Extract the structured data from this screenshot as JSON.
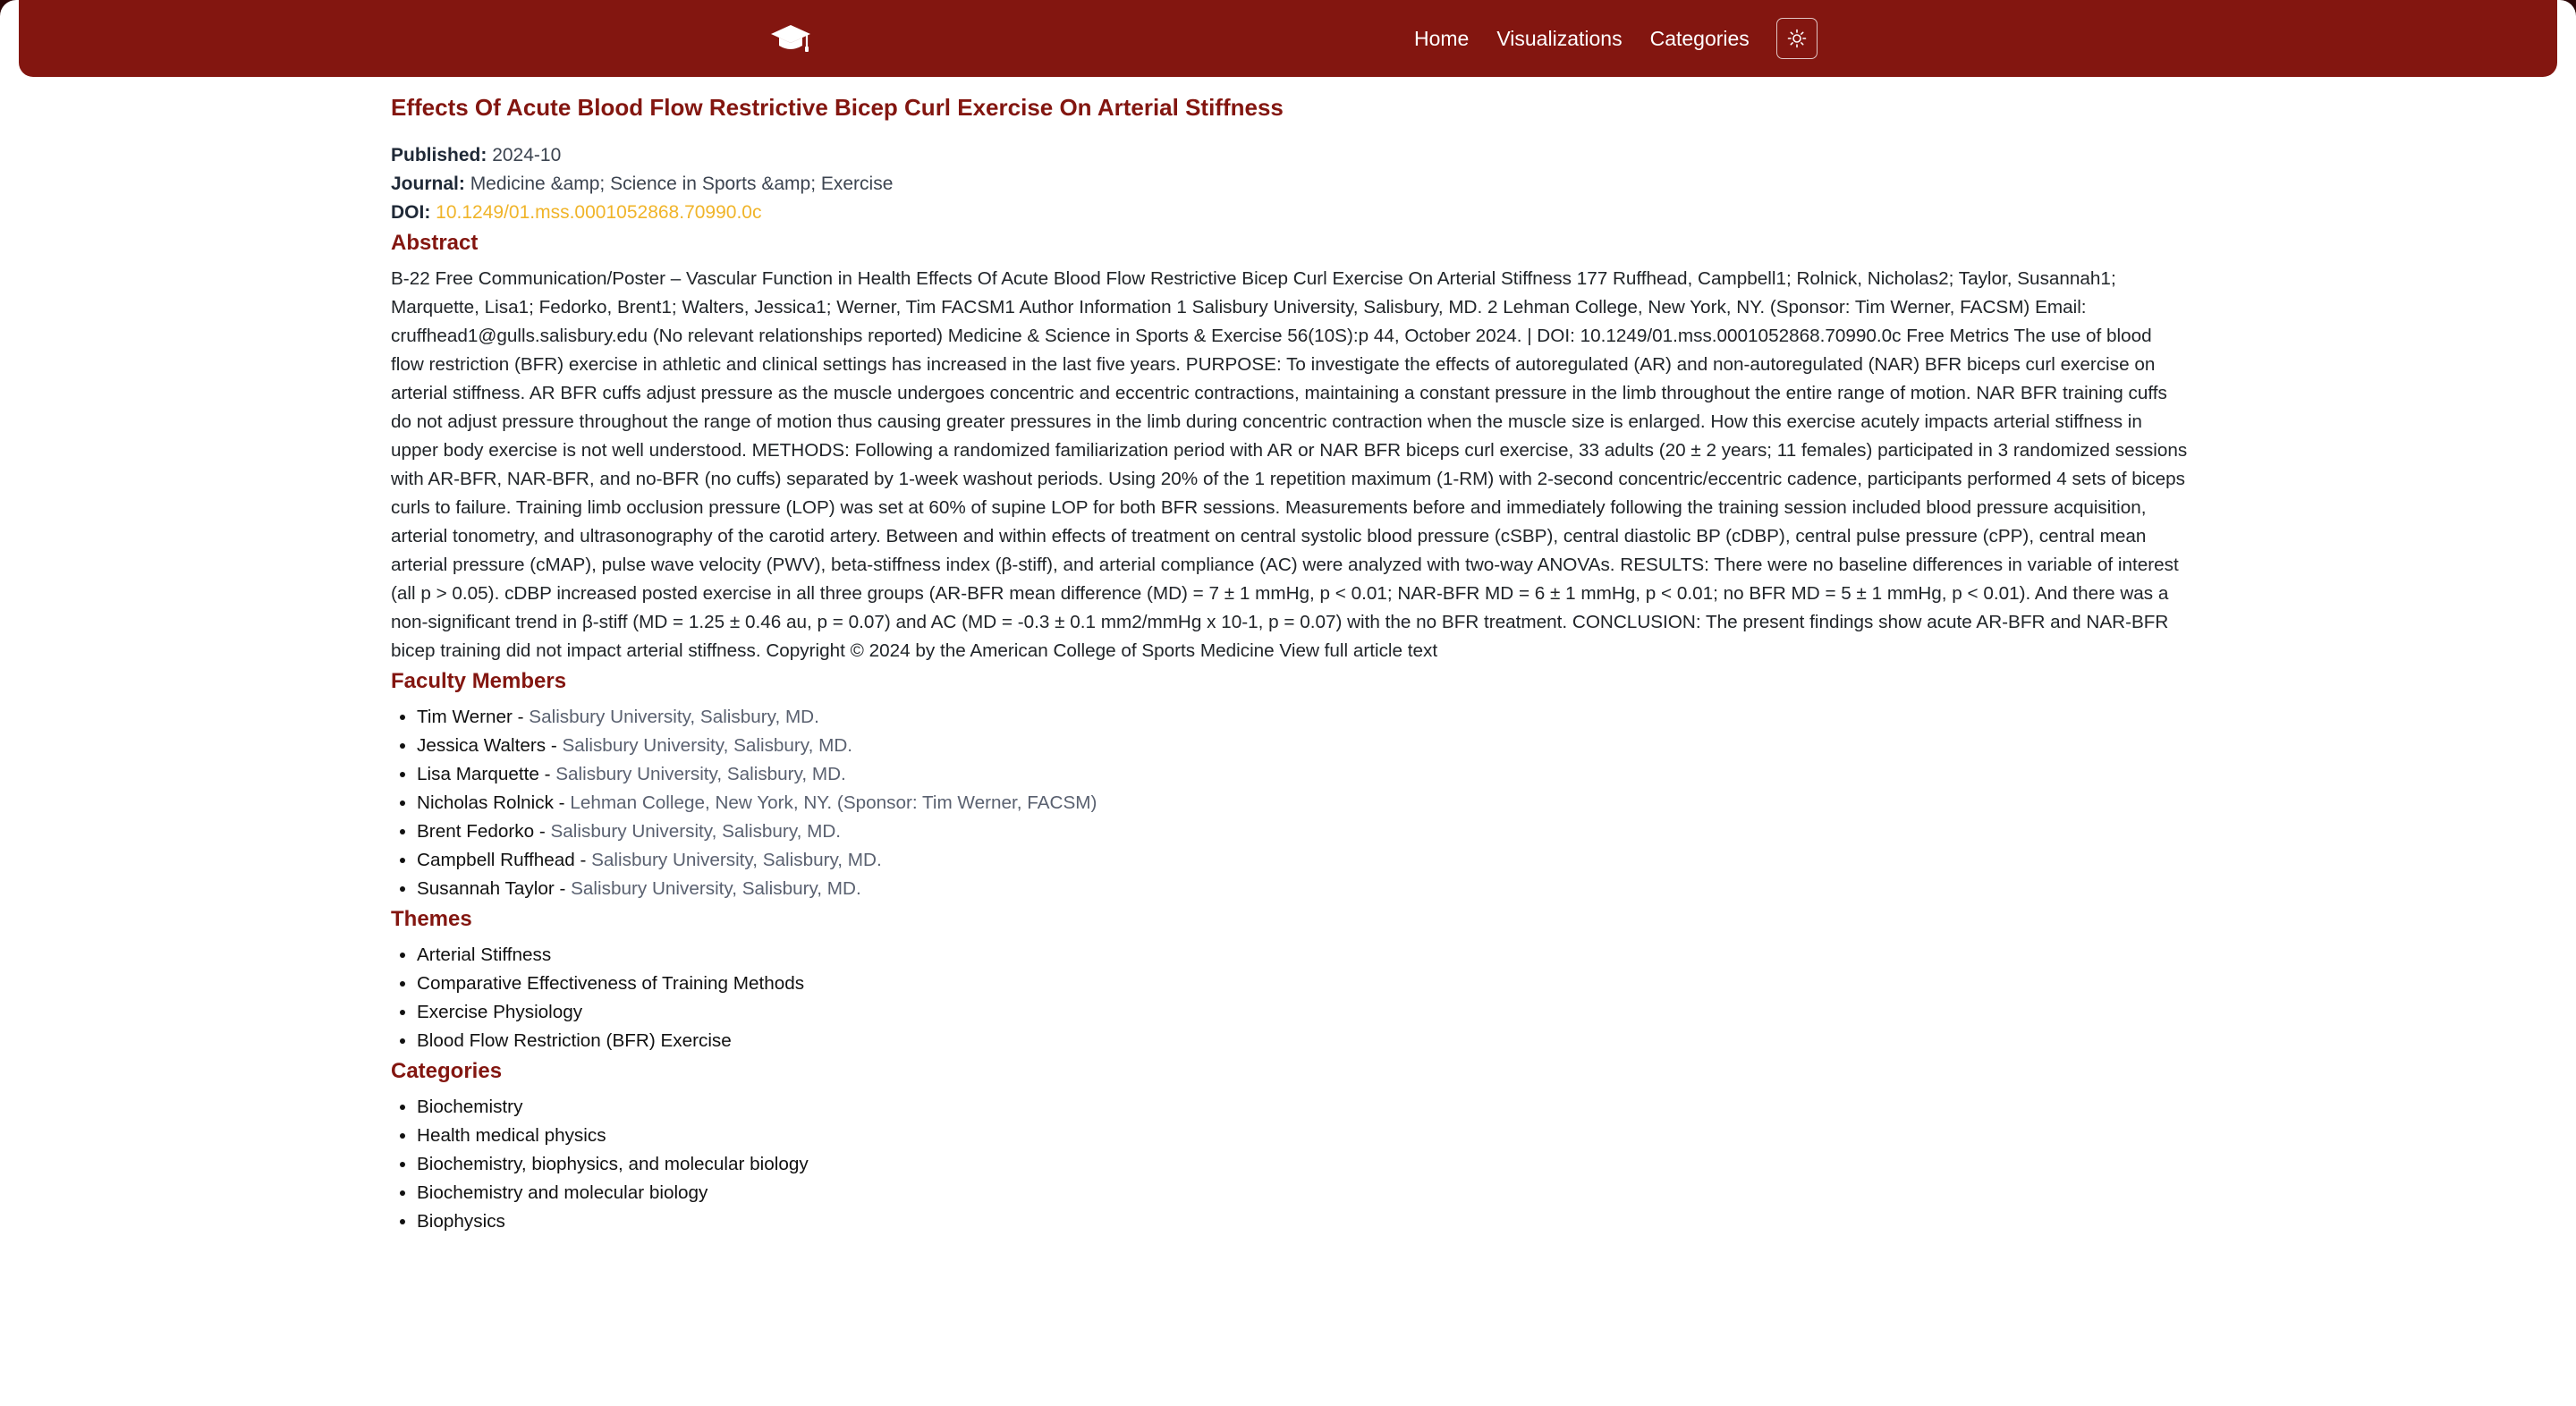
{
  "nav": {
    "links": [
      "Home",
      "Visualizations",
      "Categories"
    ]
  },
  "icons": {
    "logo": "graduation-cap-icon",
    "theme_toggle": "sun-icon"
  },
  "colors": {
    "brand": "#831610",
    "doi_link": "#f0b429",
    "background": "#ffffff"
  },
  "article": {
    "title": "Effects Of Acute Blood Flow Restrictive Bicep Curl Exercise On Arterial Stiffness",
    "published_label": "Published:",
    "published": "2024-10",
    "journal_label": "Journal:",
    "journal": "Medicine &amp; Science in Sports &amp; Exercise",
    "doi_label": "DOI:",
    "doi": "10.1249/01.mss.0001052868.70990.0c"
  },
  "abstract": {
    "heading": "Abstract",
    "text": "B-22 Free Communication/Poster – Vascular Function in Health Effects Of Acute Blood Flow Restrictive Bicep Curl Exercise On Arterial Stiffness 177 Ruffhead, Campbell1; Rolnick, Nicholas2; Taylor, Susannah1; Marquette, Lisa1; Fedorko, Brent1; Walters, Jessica1; Werner, Tim FACSM1 Author Information 1 Salisbury University, Salisbury, MD. 2 Lehman College, New York, NY. (Sponsor: Tim Werner, FACSM) Email: cruffhead1@gulls.salisbury.edu (No relevant relationships reported) Medicine & Science in Sports & Exercise 56(10S):p 44, October 2024. | DOI: 10.1249/01.mss.0001052868.70990.0c Free Metrics The use of blood flow restriction (BFR) exercise in athletic and clinical settings has increased in the last five years. PURPOSE: To investigate the effects of autoregulated (AR) and non-autoregulated (NAR) BFR biceps curl exercise on arterial stiffness. AR BFR cuffs adjust pressure as the muscle undergoes concentric and eccentric contractions, maintaining a constant pressure in the limb throughout the entire range of motion. NAR BFR training cuffs do not adjust pressure throughout the range of motion thus causing greater pressures in the limb during concentric contraction when the muscle size is enlarged. How this exercise acutely impacts arterial stiffness in upper body exercise is not well understood. METHODS: Following a randomized familiarization period with AR or NAR BFR biceps curl exercise, 33 adults (20 ± 2 years; 11 females) participated in 3 randomized sessions with AR-BFR, NAR-BFR, and no-BFR (no cuffs) separated by 1-week washout periods. Using 20% of the 1 repetition maximum (1-RM) with 2-second concentric/eccentric cadence, participants performed 4 sets of biceps curls to failure. Training limb occlusion pressure (LOP) was set at 60% of supine LOP for both BFR sessions. Measurements before and immediately following the training session included blood pressure acquisition, arterial tonometry, and ultrasonography of the carotid artery. Between and within effects of treatment on central systolic blood pressure (cSBP), central diastolic BP (cDBP), central pulse pressure (cPP), central mean arterial pressure (cMAP), pulse wave velocity (PWV), beta-stiffness index (β-stiff), and arterial compliance (AC) were analyzed with two-way ANOVAs. RESULTS: There were no baseline differences in variable of interest (all p > 0.05). cDBP increased posted exercise in all three groups (AR-BFR mean difference (MD) = 7 ± 1 mmHg, p < 0.01; NAR-BFR MD = 6 ± 1 mmHg, p < 0.01; no BFR MD = 5 ± 1 mmHg, p < 0.01). And there was a non-significant trend in β-stiff (MD = 1.25 ± 0.46 au, p = 0.07) and AC (MD = -0.3 ± 0.1 mm2/mmHg x 10-1, p = 0.07) with the no BFR treatment. CONCLUSION: The present findings show acute AR-BFR and NAR-BFR bicep training did not impact arterial stiffness. Copyright © 2024 by the American College of Sports Medicine View full article text"
  },
  "faculty": {
    "heading": "Faculty Members",
    "members": [
      {
        "name": "Tim Werner",
        "sep": " - ",
        "affiliation": "Salisbury University, Salisbury, MD."
      },
      {
        "name": "Jessica Walters",
        "sep": " - ",
        "affiliation": "Salisbury University, Salisbury, MD."
      },
      {
        "name": "Lisa Marquette",
        "sep": " - ",
        "affiliation": "Salisbury University, Salisbury, MD."
      },
      {
        "name": "Nicholas Rolnick",
        "sep": " - ",
        "affiliation": "Lehman College, New York, NY. (Sponsor: Tim Werner, FACSM)"
      },
      {
        "name": "Brent Fedorko",
        "sep": " - ",
        "affiliation": "Salisbury University, Salisbury, MD."
      },
      {
        "name": "Campbell Ruffhead",
        "sep": " - ",
        "affiliation": "Salisbury University, Salisbury, MD."
      },
      {
        "name": "Susannah Taylor",
        "sep": " - ",
        "affiliation": "Salisbury University, Salisbury, MD."
      }
    ]
  },
  "themes": {
    "heading": "Themes",
    "items": [
      "Arterial Stiffness",
      "Comparative Effectiveness of Training Methods",
      "Exercise Physiology",
      "Blood Flow Restriction (BFR) Exercise"
    ]
  },
  "categories": {
    "heading": "Categories",
    "items": [
      "Biochemistry",
      "Health medical physics",
      "Biochemistry, biophysics, and molecular biology",
      "Biochemistry and molecular biology",
      "Biophysics"
    ]
  }
}
